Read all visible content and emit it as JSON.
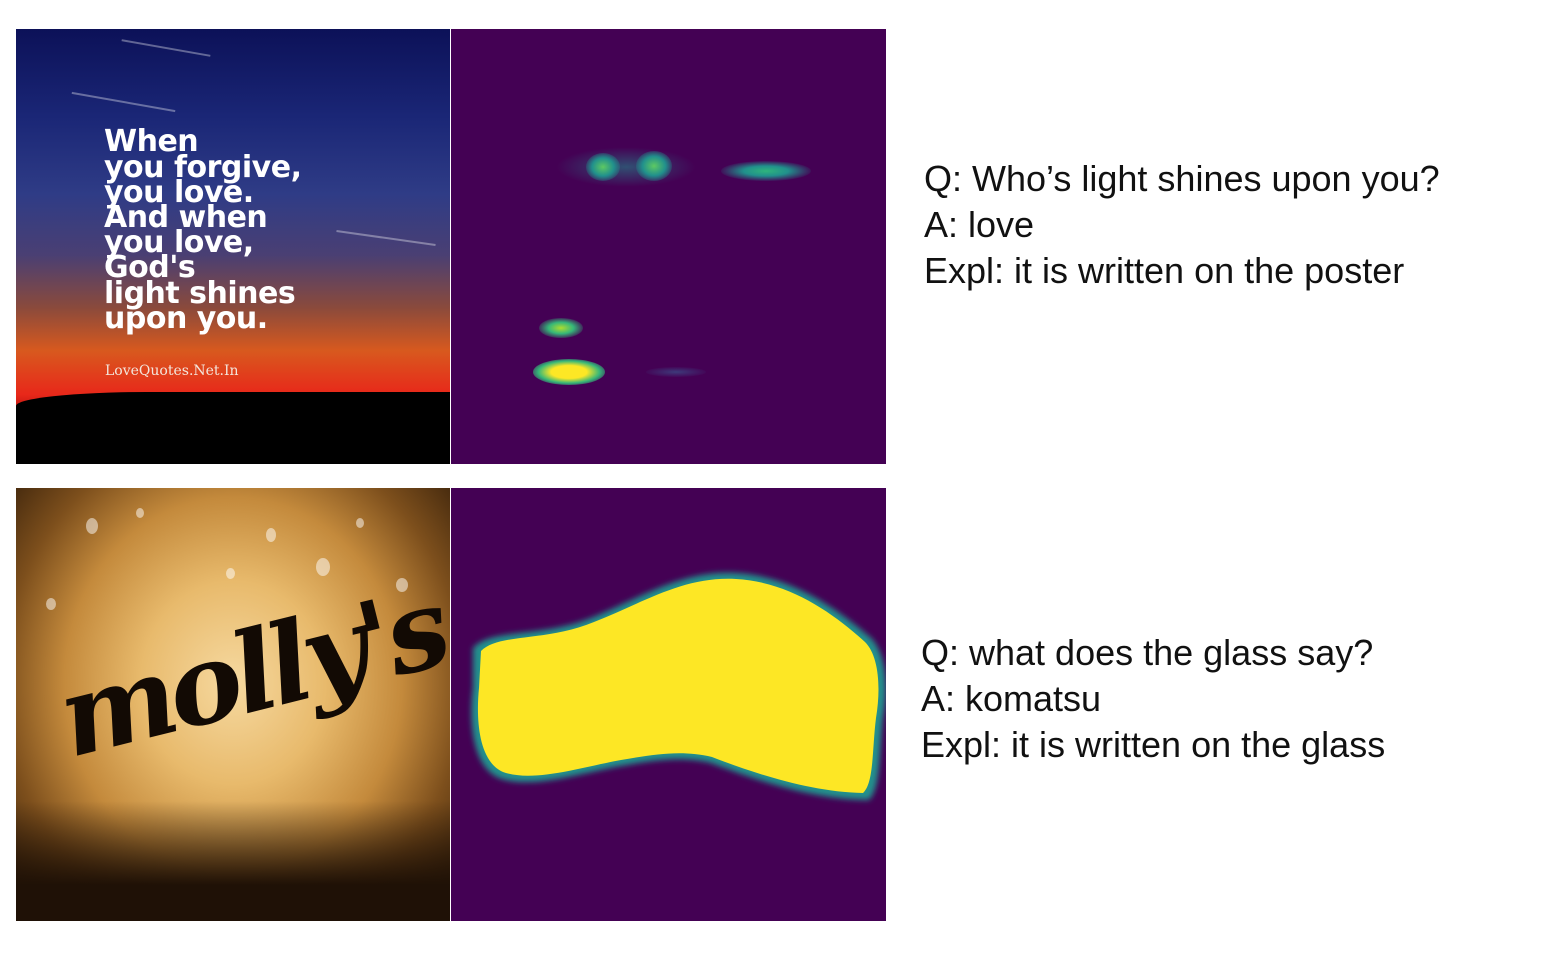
{
  "rows": [
    {
      "image": {
        "kind": "poster",
        "quote_lines": [
          "When",
          "you forgive,",
          "you love.",
          "And when",
          "you love,",
          "God's",
          "light shines",
          "upon you."
        ],
        "watermark": "LoveQuotes.Net.In"
      },
      "heatmap": {
        "colormap": "viridis"
      },
      "question": "Q: Who’s light shines upon you?",
      "answer": "A: love",
      "explanation": "Expl: it is written on the poster"
    },
    {
      "image": {
        "kind": "glass",
        "logo_text": "molly's"
      },
      "heatmap": {
        "colormap": "viridis"
      },
      "question": "Q: what does the glass say?",
      "answer": "A: komatsu",
      "explanation": "Expl: it is written on the glass"
    }
  ],
  "colors": {
    "heatmap_background": "#440154",
    "heatmap_mid": "#21908c",
    "heatmap_high": "#fde725"
  }
}
